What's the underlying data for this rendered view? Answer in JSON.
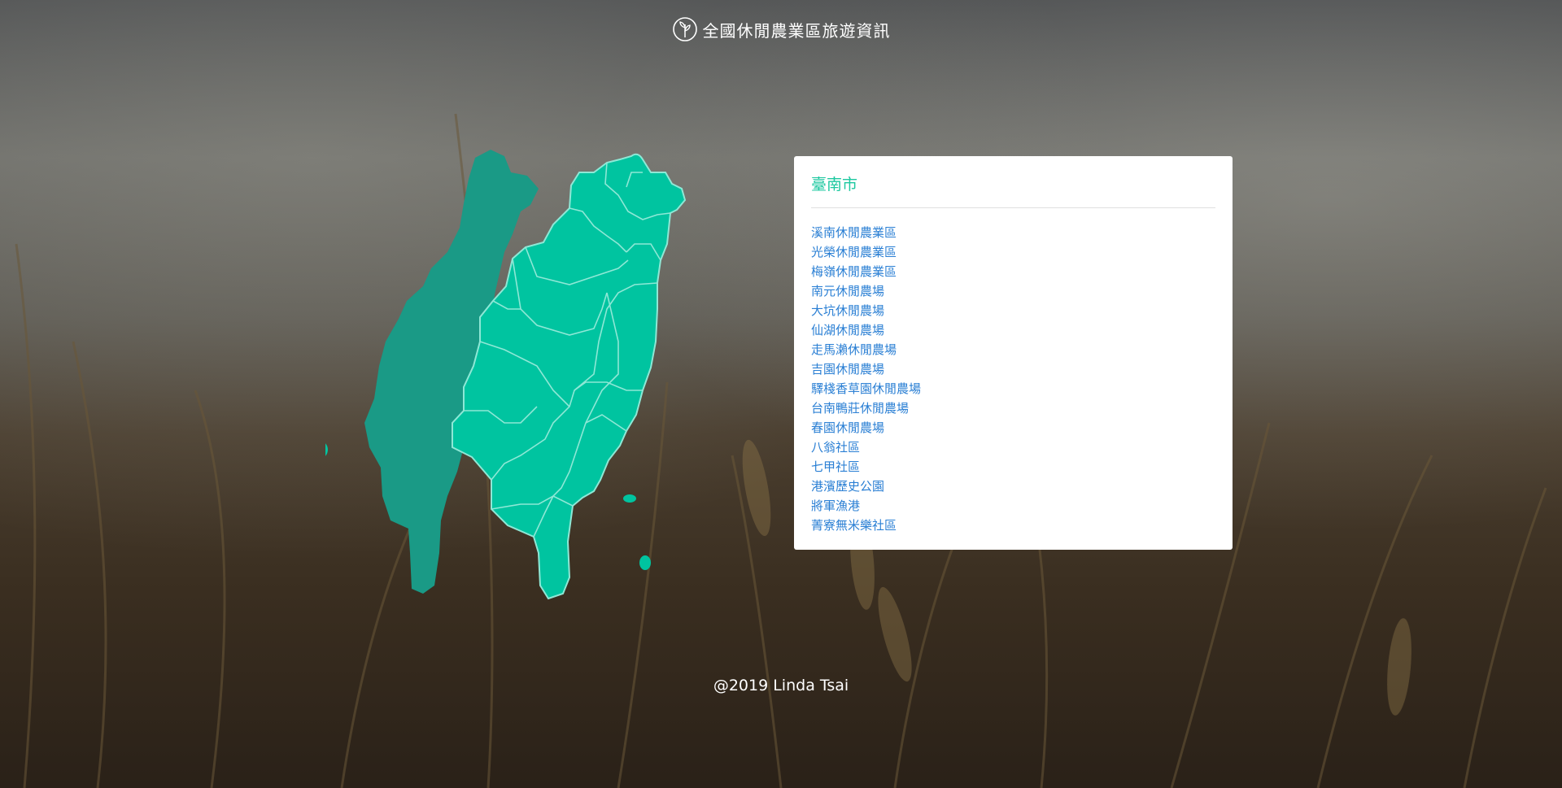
{
  "header": {
    "title": "全國休閒農業區旅遊資訊",
    "icon": "leaf-logo-icon"
  },
  "map": {
    "region_color": "#00c4a0",
    "shadow_color": "#1a9a86",
    "border_color": "#8ee8d6"
  },
  "panel": {
    "city": "臺南市",
    "items": [
      "溪南休閒農業區",
      "光榮休閒農業區",
      "梅嶺休閒農業區",
      "南元休閒農場",
      "大坑休閒農場",
      "仙湖休閒農場",
      "走馬瀨休閒農場",
      "吉園休閒農場",
      "驛棧香草園休閒農場",
      "台南鴨莊休閒農場",
      "春園休閒農場",
      "八翁社區",
      "七甲社區",
      "港濱歷史公園",
      "將軍漁港",
      "菁寮無米樂社區"
    ]
  },
  "footer": {
    "text": "@2019 Linda Tsai"
  }
}
